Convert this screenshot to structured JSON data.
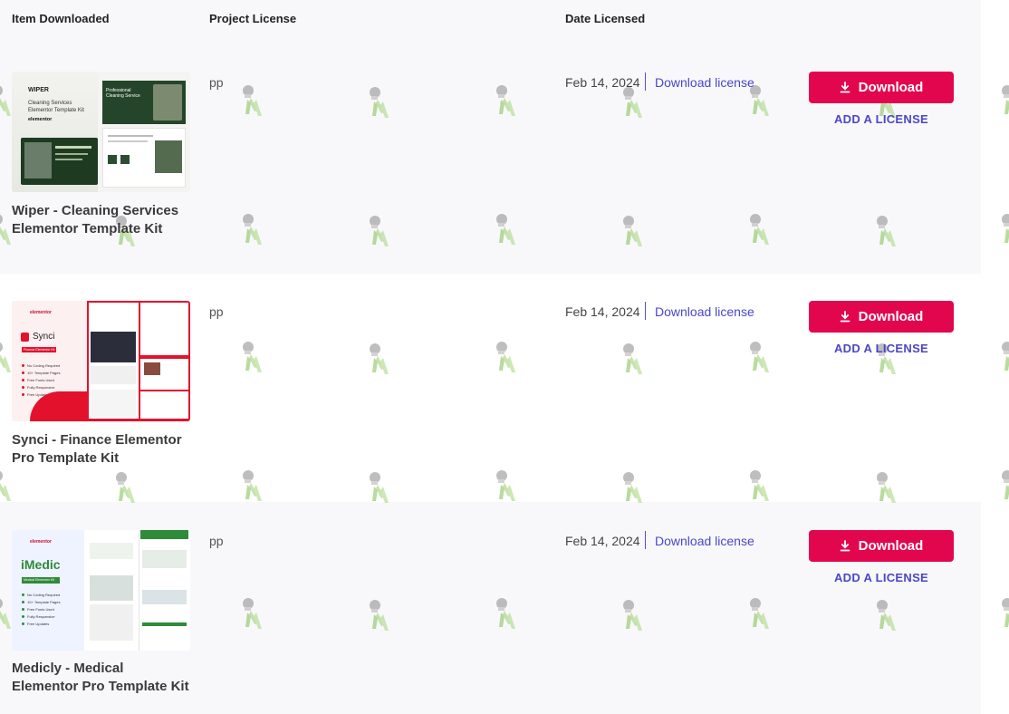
{
  "header": {
    "col_item": "Item Downloaded",
    "col_license": "Project License",
    "col_date": "Date Licensed"
  },
  "rows": [
    {
      "title": "Wiper - Cleaning Services Elementor Template Kit",
      "license": "pp",
      "date": "Feb 14, 2024",
      "download_license": "Download license",
      "download_label": "Download",
      "add_license": "ADD A LICENSE",
      "thumb": {
        "heading": "WIPER",
        "sub": "Cleaning Services Elementor Template Kit",
        "brand": "elementor",
        "promo": "Professional Cleaning Service"
      }
    },
    {
      "title": "Synci - Finance Elementor Pro Template Kit",
      "license": "pp",
      "date": "Feb 14, 2024",
      "download_license": "Download license",
      "download_label": "Download",
      "add_license": "ADD A LICENSE",
      "thumb": {
        "heading": "Synci",
        "badge": "Finance Elementor Kit",
        "brand": "elementor",
        "features": [
          "No Coding Required",
          "10+ Template Pages",
          "Free Fonts Used",
          "Fully Responsive",
          "Free Updates"
        ]
      }
    },
    {
      "title": "Medicly - Medical Elementor Pro Template Kit",
      "license": "pp",
      "date": "Feb 14, 2024",
      "download_license": "Download license",
      "download_label": "Download",
      "add_license": "ADD A LICENSE",
      "thumb": {
        "heading": "iMedic",
        "badge": "Medical Elementor Kit",
        "brand": "elementor",
        "features": [
          "No Coding Required",
          "10+ Template Pages",
          "Free Fonts Used",
          "Fully Responsive",
          "Free Updates"
        ]
      }
    }
  ],
  "colors": {
    "accent": "#e2064f",
    "link": "#4a46c8",
    "page_bg": "#f8f8fb"
  },
  "icons": {
    "download": "download-icon",
    "watermark": "watermark-figure-icon"
  }
}
